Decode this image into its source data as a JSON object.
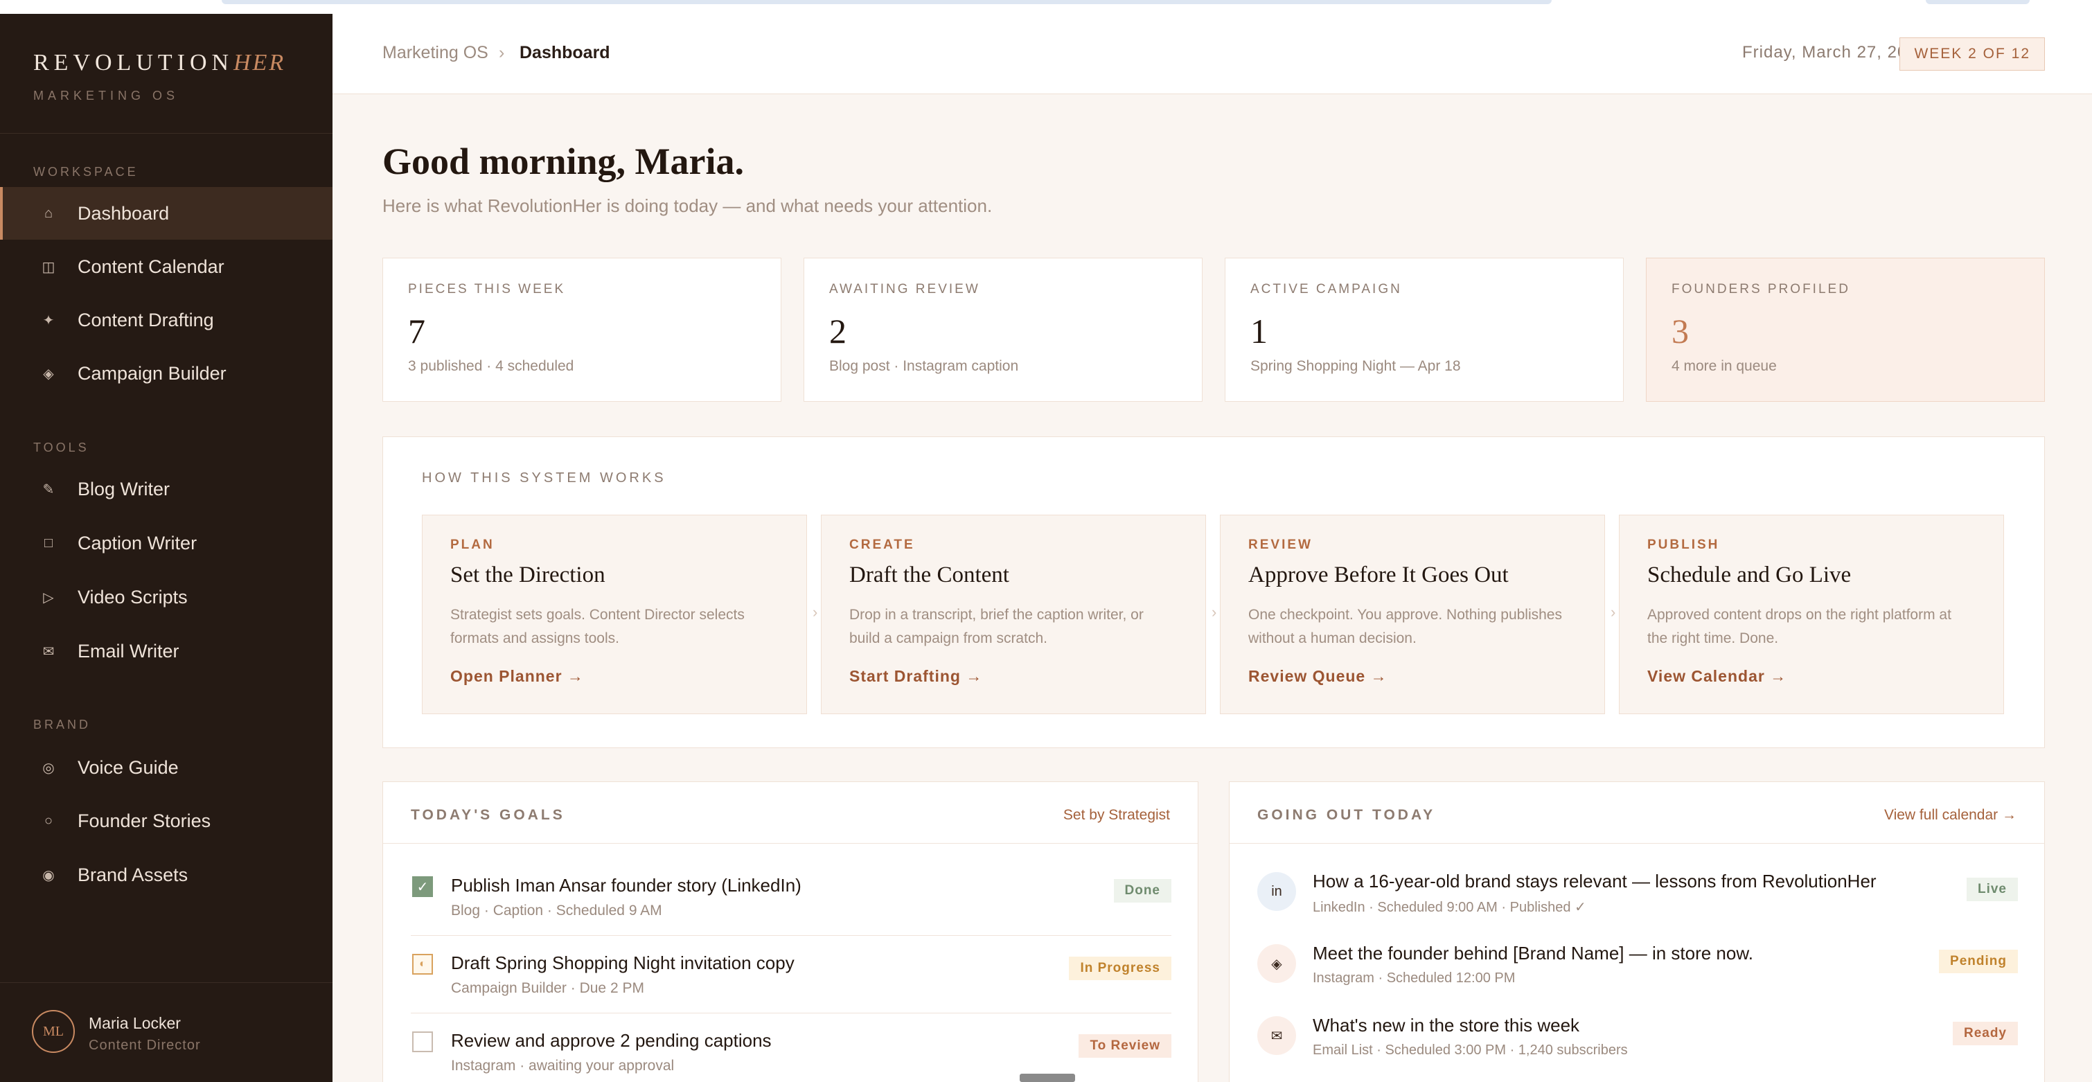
{
  "brand": {
    "name_main": "REVOLUTION",
    "name_accent": "HER",
    "subtitle": "MARKETING OS"
  },
  "sidebar": {
    "workspace_label": "WORKSPACE",
    "workspace": [
      {
        "label": "Dashboard",
        "icon": "home-icon",
        "glyph": "⌂"
      },
      {
        "label": "Content Calendar",
        "icon": "calendar-icon",
        "glyph": "◫"
      },
      {
        "label": "Content Drafting",
        "icon": "sparkle-icon",
        "glyph": "✦"
      },
      {
        "label": "Campaign Builder",
        "icon": "diamond-icon",
        "glyph": "◈"
      }
    ],
    "tools_label": "TOOLS",
    "tools": [
      {
        "label": "Blog Writer",
        "icon": "pencil-icon",
        "glyph": "✎"
      },
      {
        "label": "Caption Writer",
        "icon": "square-icon",
        "glyph": "□"
      },
      {
        "label": "Video Scripts",
        "icon": "play-icon",
        "glyph": "▷"
      },
      {
        "label": "Email Writer",
        "icon": "mail-icon",
        "glyph": "✉"
      }
    ],
    "brand_label": "BRAND",
    "brand_items": [
      {
        "label": "Voice Guide",
        "icon": "target-icon",
        "glyph": "◎"
      },
      {
        "label": "Founder Stories",
        "icon": "circle-icon",
        "glyph": "○"
      },
      {
        "label": "Brand Assets",
        "icon": "dot-circle-icon",
        "glyph": "◉"
      }
    ],
    "user": {
      "initials": "ML",
      "name": "Maria Locker",
      "role": "Content Director"
    }
  },
  "header": {
    "crumb_root": "Marketing OS",
    "crumb_sep": "›",
    "crumb_current": "Dashboard",
    "date": "Friday, March 27, 2026",
    "week": "WEEK 2 OF 12"
  },
  "greeting": {
    "title": "Good morning, Maria.",
    "subtitle": "Here is what RevolutionHer is doing today — and what needs your attention."
  },
  "stats": [
    {
      "label": "PIECES THIS WEEK",
      "value": "7",
      "note": "3 published · 4 scheduled"
    },
    {
      "label": "AWAITING REVIEW",
      "value": "2",
      "note": "Blog post · Instagram caption"
    },
    {
      "label": "ACTIVE CAMPAIGN",
      "value": "1",
      "note": "Spring Shopping Night — Apr 18"
    },
    {
      "label": "FOUNDERS PROFILED",
      "value": "3",
      "note": "4 more in queue"
    }
  ],
  "how": {
    "title": "HOW THIS SYSTEM WORKS",
    "arrow": "›",
    "steps": [
      {
        "tag": "PLAN",
        "title": "Set the Direction",
        "desc": "Strategist sets goals. Content Director selects formats and assigns tools.",
        "link": "Open Planner →"
      },
      {
        "tag": "CREATE",
        "title": "Draft the Content",
        "desc": "Drop in a transcript, brief the caption writer, or build a campaign from scratch.",
        "link": "Start Drafting →"
      },
      {
        "tag": "REVIEW",
        "title": "Approve Before It Goes Out",
        "desc": "One checkpoint. You approve. Nothing publishes without a human decision.",
        "link": "Review Queue →"
      },
      {
        "tag": "PUBLISH",
        "title": "Schedule and Go Live",
        "desc": "Approved content drops on the right platform at the right time. Done.",
        "link": "View Calendar →"
      }
    ]
  },
  "goals": {
    "title": "TODAY'S GOALS",
    "link": "Set by Strategist",
    "items": [
      {
        "title": "Publish Iman Ansar founder story (LinkedIn)",
        "meta": "Blog · Caption · Scheduled 9 AM",
        "status": "Done",
        "check": "✓"
      },
      {
        "title": "Draft Spring Shopping Night invitation copy",
        "meta": "Campaign Builder · Due 2 PM",
        "status": "In Progress",
        "check": "◐"
      },
      {
        "title": "Review and approve 2 pending captions",
        "meta": "Instagram · awaiting your approval",
        "status": "To Review",
        "check": ""
      }
    ]
  },
  "going_out": {
    "title": "GOING OUT TODAY",
    "link": "View full calendar →",
    "items": [
      {
        "icon": "linkedin-icon",
        "glyph": "in",
        "bg": "#eaf0f7",
        "title": "How a 16-year-old brand stays relevant — lessons from RevolutionHer",
        "meta": "LinkedIn · Scheduled 9:00 AM · Published ✓",
        "status": "Live"
      },
      {
        "icon": "instagram-icon",
        "glyph": "◈",
        "bg": "#fbeee8",
        "title": "Meet the founder behind [Brand Name] — in store now.",
        "meta": "Instagram · Scheduled 12:00 PM",
        "status": "Pending"
      },
      {
        "icon": "email-icon",
        "glyph": "✉",
        "bg": "#fbeee8",
        "title": "What's new in the store this week",
        "meta": "Email List · Scheduled 3:00 PM · 1,240 subscribers",
        "status": "Ready"
      }
    ]
  }
}
